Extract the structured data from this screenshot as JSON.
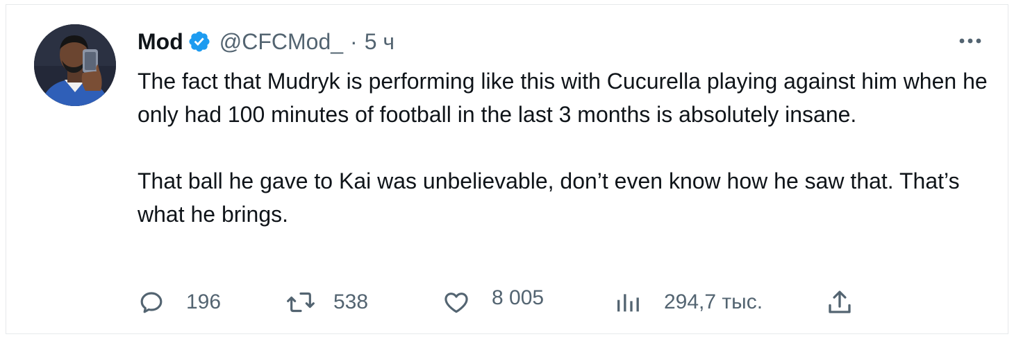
{
  "tweet": {
    "author": {
      "name": "Mod",
      "handle": "@CFCMod_",
      "separator": "·",
      "time": "5 ч",
      "verified": true,
      "verified_color": "#1d9bf0"
    },
    "paragraphs": [
      "The fact that Mudryk is performing like this with Cucurella playing against him when he only had 100 minutes of football in the last 3 months is absolutely insane.",
      "That ball he gave to Kai was unbelievable, don’t even know how he saw that. That’s what he brings."
    ],
    "actions": {
      "replies": "196",
      "retweets": "538",
      "likes": "8 005",
      "views": "294,7 тыс."
    },
    "icons": {
      "reply": "reply-icon",
      "retweet": "retweet-icon",
      "like": "heart-icon",
      "views": "views-chart-icon",
      "share": "share-icon",
      "more": "more-options-icon"
    },
    "colors": {
      "text": "#0f1419",
      "secondary": "#536471"
    }
  }
}
